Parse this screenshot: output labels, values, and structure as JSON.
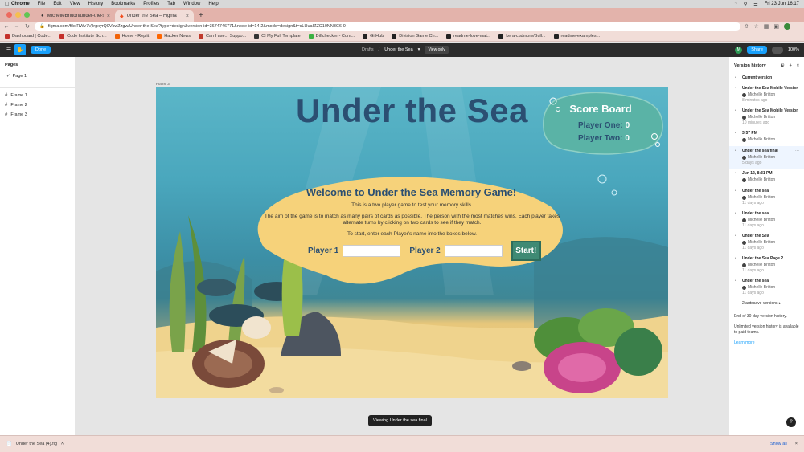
{
  "os_menubar": {
    "app": "Chrome",
    "items": [
      "File",
      "Edit",
      "View",
      "History",
      "Bookmarks",
      "Profiles",
      "Tab",
      "Window",
      "Help"
    ],
    "datetime": "Fri 23 Jun  16:17"
  },
  "tabs": [
    {
      "label": "MichelleBritton/under-the-sea",
      "active": false
    },
    {
      "label": "Under the Sea – Figma",
      "active": true
    }
  ],
  "address_bar": {
    "url": "figma.com/file/RWv7VjlrgxyrQ0VkwZzgw/Under-the-Sea?type=design&version-id=3674746771&node-id=14-2&mode=design&t=cLUuaIZZC10NN3C6-0"
  },
  "bookmarks": [
    {
      "label": "Dashboard | Code...",
      "color": "#c4302b"
    },
    {
      "label": "Code Institute Sch...",
      "color": "#c4302b"
    },
    {
      "label": "Home - Replit",
      "color": "#f26207"
    },
    {
      "label": "Hacker News",
      "color": "#ff6600"
    },
    {
      "label": "Can I use... Suppo...",
      "color": "#c0392b"
    },
    {
      "label": "CI My Full Template",
      "color": "#333333"
    },
    {
      "label": "Diffchecker - Com...",
      "color": "#3bb143"
    },
    {
      "label": "GitHub",
      "color": "#222222"
    },
    {
      "label": "Division Game Ch...",
      "color": "#222222"
    },
    {
      "label": "readme-love-mat...",
      "color": "#222222"
    },
    {
      "label": "kera-cudmore/Bull...",
      "color": "#222222"
    },
    {
      "label": "readme-examples...",
      "color": "#222222"
    }
  ],
  "figma_toolbar": {
    "done_label": "Done",
    "breadcrumb_parent": "Drafts",
    "file_name": "Under the Sea",
    "view_only_label": "View only",
    "avatar_initial": "M",
    "share_label": "Share",
    "zoom": "100%"
  },
  "pages_panel": {
    "title": "Pages",
    "pages": [
      "Page 1"
    ],
    "frames": [
      "Frame 1",
      "Frame 2",
      "Frame 3"
    ]
  },
  "canvas": {
    "frame_label": "Frame 3",
    "toast": "Viewing Under the sea final"
  },
  "game": {
    "title": "Under the Sea",
    "scoreboard": {
      "title": "Score Board",
      "player_one_label": "Player One:",
      "player_one_score": "0",
      "player_two_label": "Player Two:",
      "player_two_score": "0"
    },
    "welcome": {
      "heading": "Welcome to Under the Sea Memory Game!",
      "line1": "This is a two player game to test your memory skills.",
      "line2": "The aim of the game is to match as many pairs of cards as possible. The person with the most matches wins. Each player takes alternate turns by clicking on two cards to see if they match.",
      "line3": "To start, enter each Player's name into the boxes below.",
      "player1_label": "Player 1",
      "player2_label": "Player 2",
      "start_label": "Start!"
    }
  },
  "version_history": {
    "title": "Version history",
    "current_label": "Current version",
    "versions": [
      {
        "title": "Under the Sea Mobile Version",
        "author": "Michelle Britton",
        "time": "8 minutes ago"
      },
      {
        "title": "Under the Sea Mobile Version",
        "author": "Michelle Britton",
        "time": "10 minutes ago"
      },
      {
        "title": "3:57 PM",
        "author": "Michelle Britton",
        "time": ""
      },
      {
        "title": "Under the sea final",
        "author": "Michelle Britton",
        "time": "5 days ago"
      },
      {
        "title": "Jun 12, 8:31 PM",
        "author": "Michelle Britton",
        "time": ""
      },
      {
        "title": "Under the sea",
        "author": "Michelle Britton",
        "time": "11 days ago"
      },
      {
        "title": "Under the sea",
        "author": "Michelle Britton",
        "time": "11 days ago"
      },
      {
        "title": "Under the Sea",
        "author": "Michelle Britton",
        "time": "11 days ago"
      },
      {
        "title": "Under the Sea Page 2",
        "author": "Michelle Britton",
        "time": "11 days ago"
      },
      {
        "title": "Under the sea",
        "author": "Michelle Britton",
        "time": "11 days ago"
      }
    ],
    "autosave": "2 autosave versions",
    "end_note": "End of 30-day version history.",
    "unlimited_note": "Unlimited version history is available to paid teams.",
    "learn_more": "Learn more"
  },
  "downloads_bar": {
    "file_name": "Under the Sea (4).fig",
    "show_all": "Show all"
  }
}
